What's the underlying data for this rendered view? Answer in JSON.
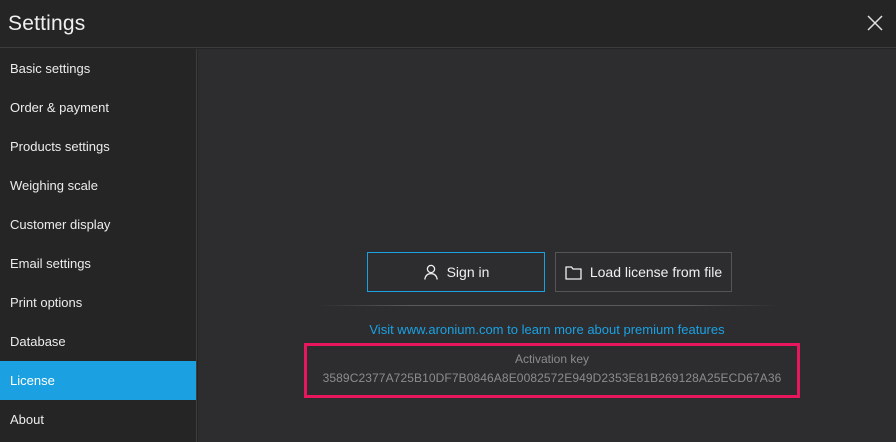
{
  "window": {
    "title": "Settings",
    "close_icon": "close-icon"
  },
  "sidebar": {
    "items": [
      {
        "label": "Basic settings",
        "active": false
      },
      {
        "label": "Order & payment",
        "active": false
      },
      {
        "label": "Products settings",
        "active": false
      },
      {
        "label": "Weighing scale",
        "active": false
      },
      {
        "label": "Customer display",
        "active": false
      },
      {
        "label": "Email settings",
        "active": false
      },
      {
        "label": "Print options",
        "active": false
      },
      {
        "label": "Database",
        "active": false
      },
      {
        "label": "License",
        "active": true
      },
      {
        "label": "About",
        "active": false
      }
    ]
  },
  "license": {
    "sign_in_label": "Sign in",
    "sign_in_icon": "user-icon",
    "load_license_label": "Load license from file",
    "load_license_icon": "folder-icon",
    "visit_link": "Visit www.aronium.com to learn more about premium features",
    "activation_key_label": "Activation key",
    "activation_key_value": "3589C2377A725B10DF7B0846A8E0082572E949D2353E81B269128A25ECD67A36"
  },
  "colors": {
    "accent": "#1ba1e2",
    "highlight_box": "#e8175d",
    "background": "#2d2d30",
    "sidebar_bg": "#252526"
  }
}
